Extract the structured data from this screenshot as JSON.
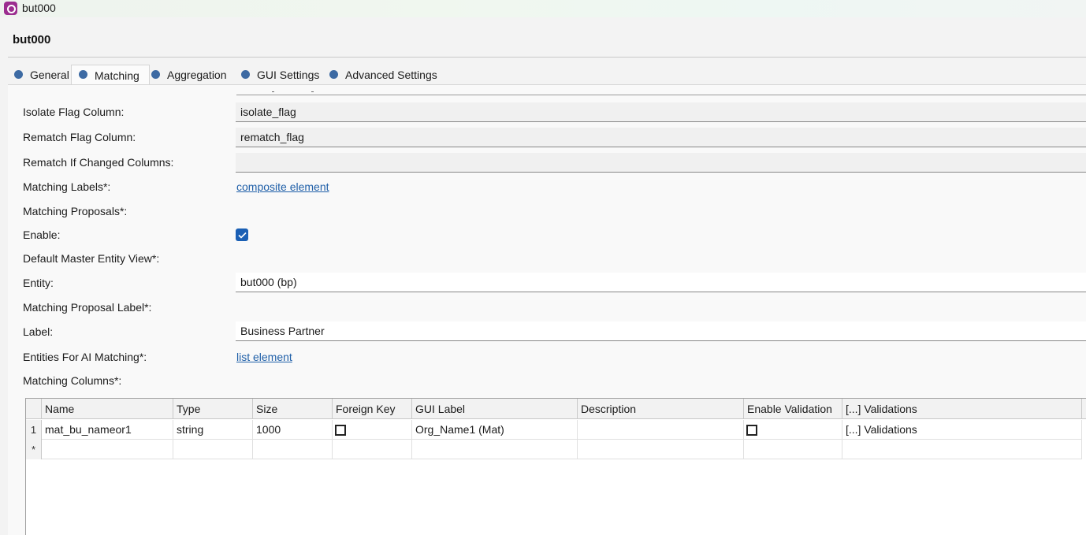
{
  "window": {
    "title": "but000"
  },
  "editor": {
    "title": "but000"
  },
  "tabs": [
    {
      "label": "General"
    },
    {
      "label": "Matching"
    },
    {
      "label": "Aggregation"
    },
    {
      "label": "GUI Settings"
    },
    {
      "label": "Advanced Settings"
    }
  ],
  "form": {
    "isolate_flag": {
      "label": "Isolate Flag Column:",
      "value": "isolate_flag"
    },
    "rematch_flag": {
      "label": "Rematch Flag Column:",
      "value": "rematch_flag"
    },
    "rematch_if_changed": {
      "label": "Rematch If Changed Columns:",
      "value": ""
    },
    "matching_labels": {
      "label": "Matching Labels*:",
      "link": "composite element"
    },
    "matching_proposals": {
      "label": "Matching Proposals*:"
    },
    "enable": {
      "label": "Enable:",
      "checked": true
    },
    "default_master_entity_view": {
      "label": "Default Master Entity View*:"
    },
    "entity": {
      "label": "Entity:",
      "value": "but000 (bp)"
    },
    "matching_proposal_label": {
      "label": "Matching Proposal Label*:"
    },
    "label": {
      "label": "Label:",
      "value": "Business Partner"
    },
    "entities_for_ai": {
      "label": "Entities For AI Matching*:",
      "link": "list element"
    },
    "matching_columns": {
      "label": "Matching Columns*:"
    }
  },
  "grid": {
    "columns": [
      "Name",
      "Type",
      "Size",
      "Foreign Key",
      "GUI Label",
      "Description",
      "Enable Validation",
      "[...] Validations"
    ],
    "rows": [
      {
        "num": "1",
        "name": "mat_bu_nameor1",
        "type": "string",
        "size": "1000",
        "foreign_key": false,
        "gui_label": "Org_Name1 (Mat)",
        "description": "",
        "enable_validation": false,
        "validations": "[...] Validations"
      }
    ],
    "new_row_marker": "*"
  },
  "colors": {
    "accent": "#1a5fb4",
    "link": "#1f5fa8",
    "app_icon": "#9b2d8f",
    "tab_dot": "#3d6aa3"
  }
}
